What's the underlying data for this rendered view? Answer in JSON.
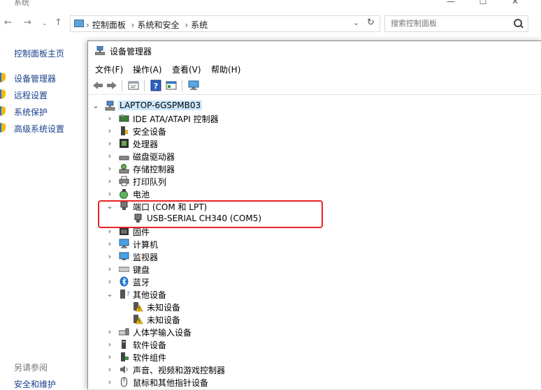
{
  "system_window": {
    "title": "系统",
    "breadcrumbs": [
      "控制面板",
      "系统和安全",
      "系统"
    ],
    "search_placeholder": "搜索控制面板",
    "window_controls": [
      "minimize-icon",
      "maximize-icon",
      "close-icon"
    ]
  },
  "left_pane": {
    "home": "控制面板主页",
    "items": [
      {
        "label": "设备管理器",
        "icon": "shield-icon"
      },
      {
        "label": "远程设置",
        "icon": "shield-icon"
      },
      {
        "label": "系统保护",
        "icon": "shield-icon"
      },
      {
        "label": "高级系统设置",
        "icon": "shield-icon"
      }
    ],
    "see_also": "另请参阅",
    "security": "安全和维护"
  },
  "device_manager": {
    "title": "设备管理器",
    "menu": [
      "文件(F)",
      "操作(A)",
      "查看(V)",
      "帮助(H)"
    ],
    "toolbar": [
      "back-icon",
      "forward-icon",
      "properties-icon",
      "help-icon",
      "update-driver-icon",
      "scan-hardware-icon"
    ],
    "root": "LAPTOP-6GSPMB03",
    "categories": [
      {
        "label": "IDE ATA/ATAPI 控制器",
        "icon": "ide-controller-icon",
        "expanded": false
      },
      {
        "label": "安全设备",
        "icon": "security-device-icon",
        "expanded": false
      },
      {
        "label": "处理器",
        "icon": "processor-icon",
        "expanded": false
      },
      {
        "label": "磁盘驱动器",
        "icon": "disk-drive-icon",
        "expanded": false
      },
      {
        "label": "存储控制器",
        "icon": "storage-controller-icon",
        "expanded": false
      },
      {
        "label": "打印队列",
        "icon": "printer-icon",
        "expanded": false
      },
      {
        "label": "电池",
        "icon": "battery-icon",
        "expanded": false
      },
      {
        "label": "端口 (COM 和 LPT)",
        "icon": "port-icon",
        "expanded": true,
        "children": [
          {
            "label": "USB-SERIAL CH340 (COM5)",
            "icon": "port-icon"
          }
        ]
      },
      {
        "label": "固件",
        "icon": "firmware-icon",
        "expanded": false
      },
      {
        "label": "计算机",
        "icon": "computer-icon",
        "expanded": false
      },
      {
        "label": "监视器",
        "icon": "monitor-icon",
        "expanded": false
      },
      {
        "label": "键盘",
        "icon": "keyboard-icon",
        "expanded": false
      },
      {
        "label": "蓝牙",
        "icon": "bluetooth-icon",
        "expanded": false
      },
      {
        "label": "其他设备",
        "icon": "other-devices-icon",
        "expanded": true,
        "children": [
          {
            "label": "未知设备",
            "icon": "unknown-device-warning-icon"
          },
          {
            "label": "未知设备",
            "icon": "unknown-device-warning-icon"
          }
        ]
      },
      {
        "label": "人体学输入设备",
        "icon": "hid-icon",
        "expanded": false
      },
      {
        "label": "软件设备",
        "icon": "software-device-icon",
        "expanded": false
      },
      {
        "label": "软件组件",
        "icon": "software-component-icon",
        "expanded": false
      },
      {
        "label": "声音、视频和游戏控制器",
        "icon": "sound-icon",
        "expanded": false
      },
      {
        "label": "鼠标和其他指针设备",
        "icon": "mouse-icon",
        "expanded": false
      }
    ]
  },
  "colors": {
    "link_blue": "#1a3e8c",
    "selection": "#cce8ff",
    "annotation_red": "#e8232a"
  }
}
